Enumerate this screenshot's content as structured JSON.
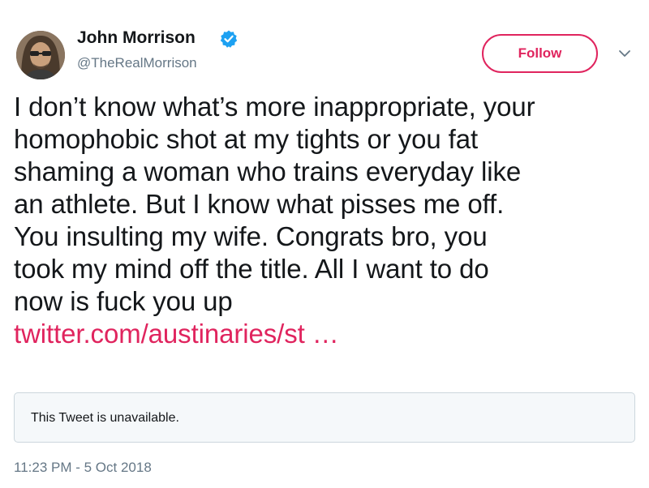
{
  "author": {
    "display_name": "John Morrison",
    "handle": "@TheRealMorrison",
    "verified": true,
    "avatar_icon": "user-avatar-photo"
  },
  "follow_button": {
    "label": "Follow",
    "color": "#e0245e"
  },
  "menu_icon": "chevron-down-icon",
  "tweet": {
    "lines": [
      "I don’t know what’s more inappropriate, your",
      "homophobic shot at my tights or you fat",
      "shaming a woman who trains everyday like",
      "an athlete.  But I know what pisses me off.",
      "You insulting my wife.  Congrats bro, you",
      "took my mind off the title.  All I want to do",
      "now is fuck you up"
    ],
    "link_text": "twitter.com/austinaries/st …",
    "link_color": "#e0245e"
  },
  "quoted_tweet": {
    "text": "This Tweet is unavailable."
  },
  "timestamp": "11:23 PM - 5 Oct 2018",
  "colors": {
    "text": "#14171a",
    "secondary": "#657786",
    "verified": "#1da1f2",
    "border": "#ccd6dd",
    "quote_bg": "#f5f8fa"
  }
}
